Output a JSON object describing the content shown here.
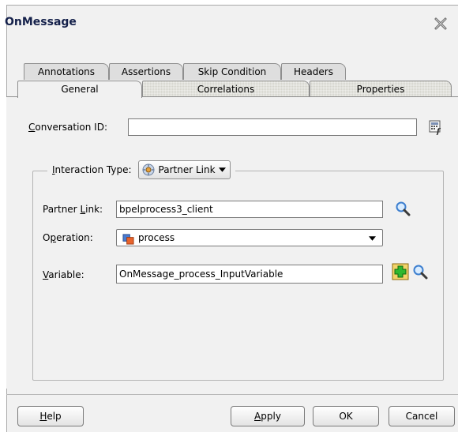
{
  "dialog": {
    "title": "OnMessage"
  },
  "tabs": {
    "back_row": [
      "Annotations",
      "Assertions",
      "Skip Condition",
      "Headers"
    ],
    "front_row": [
      "General",
      "Correlations",
      "Properties"
    ],
    "active": "General"
  },
  "general": {
    "conversation_id": {
      "label_mnemonic": "C",
      "label_rest": "onversation ID:",
      "value": ""
    },
    "interaction_type": {
      "label_mnemonic": "I",
      "label_rest": "nteraction Type:",
      "value": "Partner Link"
    },
    "partner_link": {
      "label_pre": "Partner ",
      "label_mnemonic": "L",
      "label_post": "ink:",
      "value": "bpelprocess3_client"
    },
    "operation": {
      "label_pre": "O",
      "label_mnemonic": "p",
      "label_post": "eration:",
      "value": "process"
    },
    "variable": {
      "label_mnemonic": "V",
      "label_rest": "ariable:",
      "value": "OnMessage_process_InputVariable"
    }
  },
  "buttons": {
    "help": {
      "mnemonic": "H",
      "rest": "elp"
    },
    "apply": {
      "mnemonic": "A",
      "rest": "pply"
    },
    "ok": "OK",
    "cancel": "Cancel"
  },
  "icons": {
    "close": "close-x-icon",
    "expression_builder": "expression-builder-icon",
    "search": "magnifier-icon",
    "add": "green-plus-icon",
    "partner_link": "partner-link-icon",
    "operation": "operation-icon"
  },
  "colors": {
    "title": "#14204a",
    "dialog_bg": "#f1f1f1",
    "add_green": "#2fb82f",
    "search_blue": "#3d7fcf"
  }
}
